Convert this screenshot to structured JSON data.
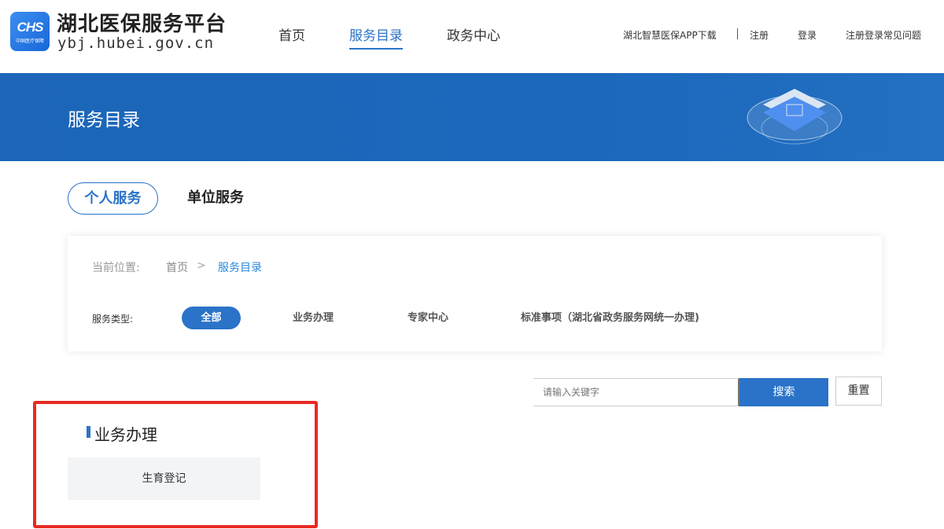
{
  "header": {
    "logo_text": "CHS",
    "logo_subtext": "中国医疗保障",
    "site_title": "湖北医保服务平台",
    "site_url": "ybj.hubei.gov.cn",
    "nav": [
      {
        "label": "首页"
      },
      {
        "label": "服务目录",
        "active": true
      },
      {
        "label": "政务中心"
      }
    ],
    "links": {
      "app_download": "湖北智慧医保APP下载",
      "register": "注册",
      "login": "登录",
      "faq": "注册登录常见问题"
    }
  },
  "banner": {
    "title": "服务目录"
  },
  "tabs": [
    {
      "label": "个人服务",
      "active": true
    },
    {
      "label": "单位服务"
    }
  ],
  "breadcrumb": {
    "label": "当前位置:",
    "home": "首页",
    "separator": ">",
    "current": "服务目录"
  },
  "filter": {
    "label": "服务类型:",
    "options": [
      {
        "label": "全部",
        "active": true
      },
      {
        "label": "业务办理"
      },
      {
        "label": "专家中心"
      },
      {
        "label": "标准事项（湖北省政务服务网统一办理)"
      }
    ]
  },
  "search": {
    "placeholder": "请输入关键字",
    "button": "搜索",
    "reset": "重置"
  },
  "section": {
    "title": "业务办理",
    "items": [
      {
        "label": "生育登记"
      }
    ]
  },
  "colors": {
    "primary": "#2a73c8",
    "banner": "#1c65b8",
    "highlight": "#e82a22"
  }
}
